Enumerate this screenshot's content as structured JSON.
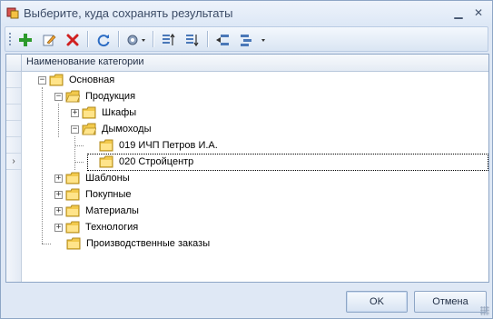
{
  "window": {
    "title": "Выберите, куда сохранять результаты",
    "controls": [
      "minimize",
      "close"
    ]
  },
  "toolbar": {
    "buttons": [
      {
        "icon": "add-icon",
        "color": "#2c9a2c"
      },
      {
        "icon": "edit-icon"
      },
      {
        "icon": "delete-icon",
        "color": "#d02020"
      },
      {
        "icon": "refresh-icon"
      },
      {
        "icon": "settings-dropdown-icon"
      },
      {
        "icon": "sort-ascending-icon"
      },
      {
        "icon": "sort-descending-icon"
      },
      {
        "icon": "move-left-icon"
      },
      {
        "icon": "move-dropdown-icon"
      }
    ]
  },
  "grid": {
    "column_header": "Наименование категории",
    "tree": [
      {
        "label": "Основная",
        "expander": "−"
      },
      {
        "label": "Продукция",
        "expander": "−"
      },
      {
        "label": "Шкафы",
        "expander": "+"
      },
      {
        "label": "Дымоходы",
        "expander": "−"
      },
      {
        "label": "019 ИЧП Петров И.А.",
        "expander": ""
      },
      {
        "label": "020 Стройцентр",
        "expander": "",
        "selected": true
      },
      {
        "label": "Шаблоны",
        "expander": "+"
      },
      {
        "label": "Покупные",
        "expander": "+"
      },
      {
        "label": "Материалы",
        "expander": "+"
      },
      {
        "label": "Технология",
        "expander": "+"
      },
      {
        "label": "Производственные заказы",
        "expander": ""
      }
    ]
  },
  "buttons": {
    "ok": "OK",
    "cancel": "Отмена"
  },
  "colors": {
    "folder": "#f2c94c",
    "accent": "#4a78b8"
  }
}
